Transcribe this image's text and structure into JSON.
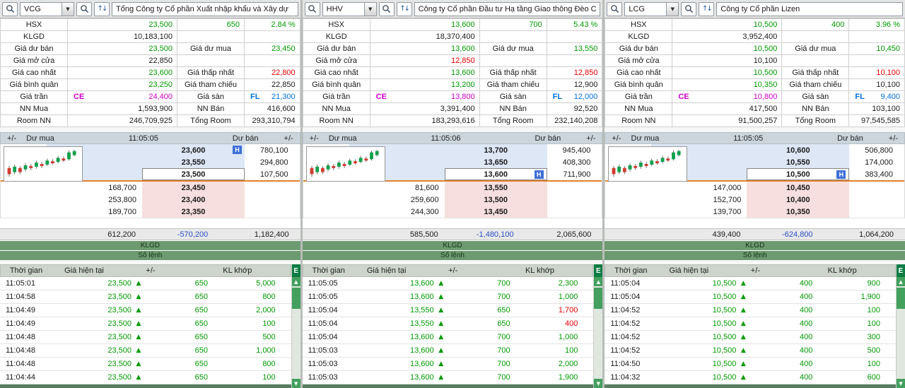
{
  "labels": {
    "klgd": "KLGD",
    "gia_du_ban": "Giá dư bán",
    "gia_du_mua": "Giá dư mua",
    "gia_mo_cua": "Giá mở cửa",
    "gia_cao_nhat": "Giá cao nhất",
    "gia_thap_nhat": "Giá thấp nhất",
    "gia_binh_quan": "Giá bình quân",
    "gia_tham_chieu": "Giá tham chiếu",
    "gia_tran": "Giá trần",
    "ce": "CE",
    "gia_san": "Giá sàn",
    "fl": "FL",
    "nn_mua": "NN Mua",
    "nn_ban": "NN Bán",
    "room_nn": "Room NN",
    "tong_room": "Tổng Room",
    "plus_minus": "+/-",
    "du_mua": "Dư mua",
    "du_ban": "Dư bán",
    "klgd_bar": "KLGD",
    "so_lenh_bar": "Số lệnh",
    "thoi_gian": "Thời gian",
    "gia_hien_tai": "Giá hiện tại",
    "kl_khop": "KL khớp",
    "e_button": "E",
    "h_badge": "H"
  },
  "icons": {
    "dropdown": "▼",
    "updown": "↑↓",
    "up_arrow": "▲",
    "scroll_up": "▲",
    "scroll_down": "▼"
  },
  "colors": {
    "up": "#009a00",
    "down": "#e60000",
    "ceiling": "#cc00cc",
    "floor": "#0072e0",
    "net_blue": "#2a4fc8",
    "bar_green": "#6d9a70",
    "ask_bg": "#dde7f6",
    "bid_bg": "#f6dfde",
    "separator_orange": "#e0822e"
  },
  "panels": [
    {
      "code": "VCG",
      "company": "Tổng Công ty Cổ phần Xuất nhập khẩu và Xây dự",
      "info": {
        "exchange": "HSX",
        "price": {
          "v": "23,500",
          "c": "up"
        },
        "change": {
          "v": "650",
          "c": "up"
        },
        "change_pct": {
          "v": "2.84 %",
          "c": "up"
        },
        "klgd": {
          "v": "10,183,100",
          "c": "k"
        },
        "du_ban": {
          "v": "23,500",
          "c": "up"
        },
        "du_mua": {
          "v": "23,450",
          "c": "up"
        },
        "mo_cua": {
          "v": "22,850",
          "c": "k"
        },
        "cao_nhat": {
          "v": "23,600",
          "c": "up"
        },
        "thap_nhat": {
          "v": "22,800",
          "c": "down"
        },
        "binh_quan": {
          "v": "23,250",
          "c": "up"
        },
        "tham_chieu": {
          "v": "22,850",
          "c": "k"
        },
        "tran": {
          "v": "24,400",
          "c": "ce"
        },
        "san": {
          "v": "21,300",
          "c": "fl"
        },
        "nn_mua": {
          "v": "1,593,900",
          "c": "k"
        },
        "nn_ban": {
          "v": "416,600",
          "c": "k"
        },
        "room_nn": {
          "v": "246,709,925",
          "c": "k"
        },
        "tong_room": {
          "v": "293,310,794",
          "c": "k"
        }
      },
      "book": {
        "time": "11:05:05",
        "asks": [
          {
            "price": "23,600",
            "vol": "780,100",
            "high": true
          },
          {
            "price": "23,550",
            "vol": "294,800"
          },
          {
            "price": "23,500",
            "vol": "107,500",
            "current": true
          }
        ],
        "bids": [
          {
            "vol": "168,700",
            "price": "23,450"
          },
          {
            "vol": "253,800",
            "price": "23,400"
          },
          {
            "vol": "189,700",
            "price": "23,350"
          }
        ],
        "total_mua": "612,200",
        "net": "-570,200",
        "total_ban": "1,182,400"
      },
      "trades": [
        {
          "time": "11:05:01",
          "price": "23,500",
          "chg": "650",
          "vol": "5,000",
          "vc": "up"
        },
        {
          "time": "11:04:58",
          "price": "23,500",
          "chg": "650",
          "vol": "800",
          "vc": "up"
        },
        {
          "time": "11:04:49",
          "price": "23,500",
          "chg": "650",
          "vol": "2,000",
          "vc": "up"
        },
        {
          "time": "11:04:49",
          "price": "23,500",
          "chg": "650",
          "vol": "100",
          "vc": "up"
        },
        {
          "time": "11:04:48",
          "price": "23,500",
          "chg": "650",
          "vol": "500",
          "vc": "up"
        },
        {
          "time": "11:04:48",
          "price": "23,500",
          "chg": "650",
          "vol": "1,000",
          "vc": "up"
        },
        {
          "time": "11:04:48",
          "price": "23,500",
          "chg": "650",
          "vol": "800",
          "vc": "up"
        },
        {
          "time": "11:04:44",
          "price": "23,500",
          "chg": "650",
          "vol": "100",
          "vc": "up"
        }
      ]
    },
    {
      "code": "HHV",
      "company": "Công ty Cổ phần Đầu tư Hạ tầng Giao thông Đèo C",
      "info": {
        "exchange": "HSX",
        "price": {
          "v": "13,600",
          "c": "up"
        },
        "change": {
          "v": "700",
          "c": "up"
        },
        "change_pct": {
          "v": "5.43 %",
          "c": "up"
        },
        "klgd": {
          "v": "18,370,400",
          "c": "k"
        },
        "du_ban": {
          "v": "13,600",
          "c": "up"
        },
        "du_mua": {
          "v": "13,550",
          "c": "up"
        },
        "mo_cua": {
          "v": "12,850",
          "c": "down"
        },
        "cao_nhat": {
          "v": "13,600",
          "c": "up"
        },
        "thap_nhat": {
          "v": "12,850",
          "c": "down"
        },
        "binh_quan": {
          "v": "13,200",
          "c": "up"
        },
        "tham_chieu": {
          "v": "12,900",
          "c": "k"
        },
        "tran": {
          "v": "13,800",
          "c": "ce"
        },
        "san": {
          "v": "12,000",
          "c": "fl"
        },
        "nn_mua": {
          "v": "3,391,400",
          "c": "k"
        },
        "nn_ban": {
          "v": "92,520",
          "c": "k"
        },
        "room_nn": {
          "v": "183,293,616",
          "c": "k"
        },
        "tong_room": {
          "v": "232,140,208",
          "c": "k"
        }
      },
      "book": {
        "time": "11:05:06",
        "asks": [
          {
            "price": "13,700",
            "vol": "945,400"
          },
          {
            "price": "13,650",
            "vol": "408,300"
          },
          {
            "price": "13,600",
            "vol": "711,900",
            "high": true,
            "current": true
          }
        ],
        "bids": [
          {
            "vol": "81,600",
            "price": "13,550"
          },
          {
            "vol": "259,600",
            "price": "13,500"
          },
          {
            "vol": "244,300",
            "price": "13,450"
          }
        ],
        "total_mua": "585,500",
        "net": "-1,480,100",
        "total_ban": "2,065,600"
      },
      "trades": [
        {
          "time": "11:05:05",
          "price": "13,600",
          "chg": "700",
          "vol": "2,300",
          "vc": "up"
        },
        {
          "time": "11:05:05",
          "price": "13,600",
          "chg": "700",
          "vol": "1,000",
          "vc": "up"
        },
        {
          "time": "11:05:04",
          "price": "13,550",
          "chg": "650",
          "vol": "1,700",
          "vc": "down"
        },
        {
          "time": "11:05:04",
          "price": "13,550",
          "chg": "650",
          "vol": "400",
          "vc": "down"
        },
        {
          "time": "11:05:04",
          "price": "13,600",
          "chg": "700",
          "vol": "1,000",
          "vc": "up"
        },
        {
          "time": "11:05:03",
          "price": "13,600",
          "chg": "700",
          "vol": "100",
          "vc": "up"
        },
        {
          "time": "11:05:03",
          "price": "13,600",
          "chg": "700",
          "vol": "2,000",
          "vc": "up"
        },
        {
          "time": "11:05:03",
          "price": "13,600",
          "chg": "700",
          "vol": "1,900",
          "vc": "up"
        }
      ]
    },
    {
      "code": "LCG",
      "company": "Công ty Cổ phần Lizen",
      "info": {
        "exchange": "HSX",
        "price": {
          "v": "10,500",
          "c": "up"
        },
        "change": {
          "v": "400",
          "c": "up"
        },
        "change_pct": {
          "v": "3.96 %",
          "c": "up"
        },
        "klgd": {
          "v": "3,952,400",
          "c": "k"
        },
        "du_ban": {
          "v": "10,500",
          "c": "up"
        },
        "du_mua": {
          "v": "10,450",
          "c": "up"
        },
        "mo_cua": {
          "v": "10,100",
          "c": "k"
        },
        "cao_nhat": {
          "v": "10,500",
          "c": "up"
        },
        "thap_nhat": {
          "v": "10,100",
          "c": "down"
        },
        "binh_quan": {
          "v": "10,350",
          "c": "up"
        },
        "tham_chieu": {
          "v": "10,100",
          "c": "k"
        },
        "tran": {
          "v": "10,800",
          "c": "ce"
        },
        "san": {
          "v": "9,400",
          "c": "fl"
        },
        "nn_mua": {
          "v": "417,500",
          "c": "k"
        },
        "nn_ban": {
          "v": "103,100",
          "c": "k"
        },
        "room_nn": {
          "v": "91,500,257",
          "c": "k"
        },
        "tong_room": {
          "v": "97,545,585",
          "c": "k"
        }
      },
      "book": {
        "time": "11:05:05",
        "asks": [
          {
            "price": "10,600",
            "vol": "506,800"
          },
          {
            "price": "10,550",
            "vol": "174,000"
          },
          {
            "price": "10,500",
            "vol": "383,400",
            "high": true,
            "current": true
          }
        ],
        "bids": [
          {
            "vol": "147,000",
            "price": "10,450"
          },
          {
            "vol": "152,700",
            "price": "10,400"
          },
          {
            "vol": "139,700",
            "price": "10,350"
          }
        ],
        "total_mua": "439,400",
        "net": "-624,800",
        "total_ban": "1,064,200"
      },
      "trades": [
        {
          "time": "11:05:04",
          "price": "10,500",
          "chg": "400",
          "vol": "900",
          "vc": "up"
        },
        {
          "time": "11:05:04",
          "price": "10,500",
          "chg": "400",
          "vol": "1,900",
          "vc": "up"
        },
        {
          "time": "11:04:52",
          "price": "10,500",
          "chg": "400",
          "vol": "100",
          "vc": "up"
        },
        {
          "time": "11:04:52",
          "price": "10,500",
          "chg": "400",
          "vol": "100",
          "vc": "up"
        },
        {
          "time": "11:04:52",
          "price": "10,500",
          "chg": "400",
          "vol": "300",
          "vc": "up"
        },
        {
          "time": "11:04:52",
          "price": "10,500",
          "chg": "400",
          "vol": "500",
          "vc": "up"
        },
        {
          "time": "11:04:50",
          "price": "10,500",
          "chg": "400",
          "vol": "100",
          "vc": "up"
        },
        {
          "time": "11:04:32",
          "price": "10,500",
          "chg": "400",
          "vol": "600",
          "vc": "up"
        }
      ]
    }
  ]
}
